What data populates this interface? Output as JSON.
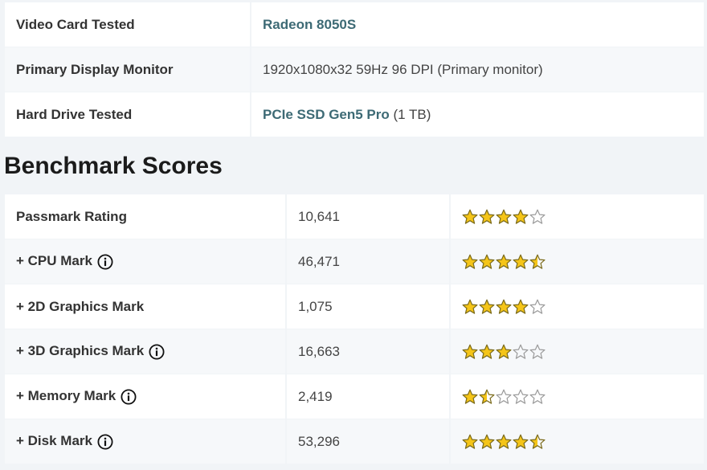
{
  "system_info": [
    {
      "label": "Video Card Tested",
      "value": "Radeon 8050S",
      "value_is_link": true,
      "suffix": ""
    },
    {
      "label": "Primary Display Monitor",
      "value": "1920x1080x32 59Hz 96 DPI (Primary monitor)",
      "value_is_link": false,
      "suffix": ""
    },
    {
      "label": "Hard Drive Tested",
      "value": "PCIe SSD Gen5 Pro",
      "value_is_link": true,
      "suffix": " (1 TB)"
    }
  ],
  "benchmark": {
    "heading": "Benchmark Scores",
    "rows": [
      {
        "name": "Passmark Rating",
        "score": "10,641",
        "rating": 4,
        "info_icon": false
      },
      {
        "name": "+ CPU Mark",
        "score": "46,471",
        "rating": 4.5,
        "info_icon": true
      },
      {
        "name": "+ 2D Graphics Mark",
        "score": "1,075",
        "rating": 4,
        "info_icon": false
      },
      {
        "name": "+ 3D Graphics Mark",
        "score": "16,663",
        "rating": 3,
        "info_icon": true
      },
      {
        "name": "+ Memory Mark",
        "score": "2,419",
        "rating": 1.5,
        "info_icon": true
      },
      {
        "name": "+ Disk Mark",
        "score": "53,296",
        "rating": 4.5,
        "info_icon": true
      }
    ],
    "max_rating": 5
  },
  "colors": {
    "link": "#3d6a75",
    "star_fill": "#f5c518",
    "star_stroke": "#7a6a1a",
    "star_empty_stroke": "#9a9a9a"
  },
  "icons": {
    "info": "info-circle-icon",
    "star": "star-icon"
  }
}
